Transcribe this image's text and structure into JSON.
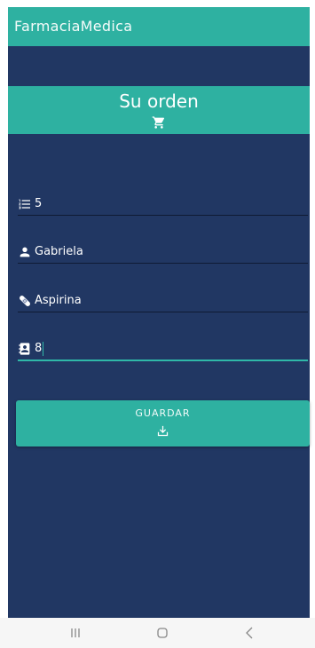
{
  "app": {
    "title": "FarmaciaMedica"
  },
  "banner": {
    "title": "Su orden",
    "icon": "shopping-cart-icon"
  },
  "form": {
    "fields": [
      {
        "name": "cantidad",
        "icon": "list-numbered-icon",
        "value": "5"
      },
      {
        "name": "cliente",
        "icon": "person-icon",
        "value": "Gabriela"
      },
      {
        "name": "medicamento",
        "icon": "bandage-icon",
        "value": "Aspirina"
      },
      {
        "name": "numero",
        "icon": "contact-book-icon",
        "value": "8"
      }
    ]
  },
  "save_button": {
    "label": "GUARDAR",
    "icon": "download-icon"
  },
  "colors": {
    "accent": "#2eb1a1",
    "background": "#213763",
    "focus_line": "#2fb8a8"
  },
  "system_nav": {
    "recents": "recents-icon",
    "home": "home-icon",
    "back": "back-icon"
  }
}
